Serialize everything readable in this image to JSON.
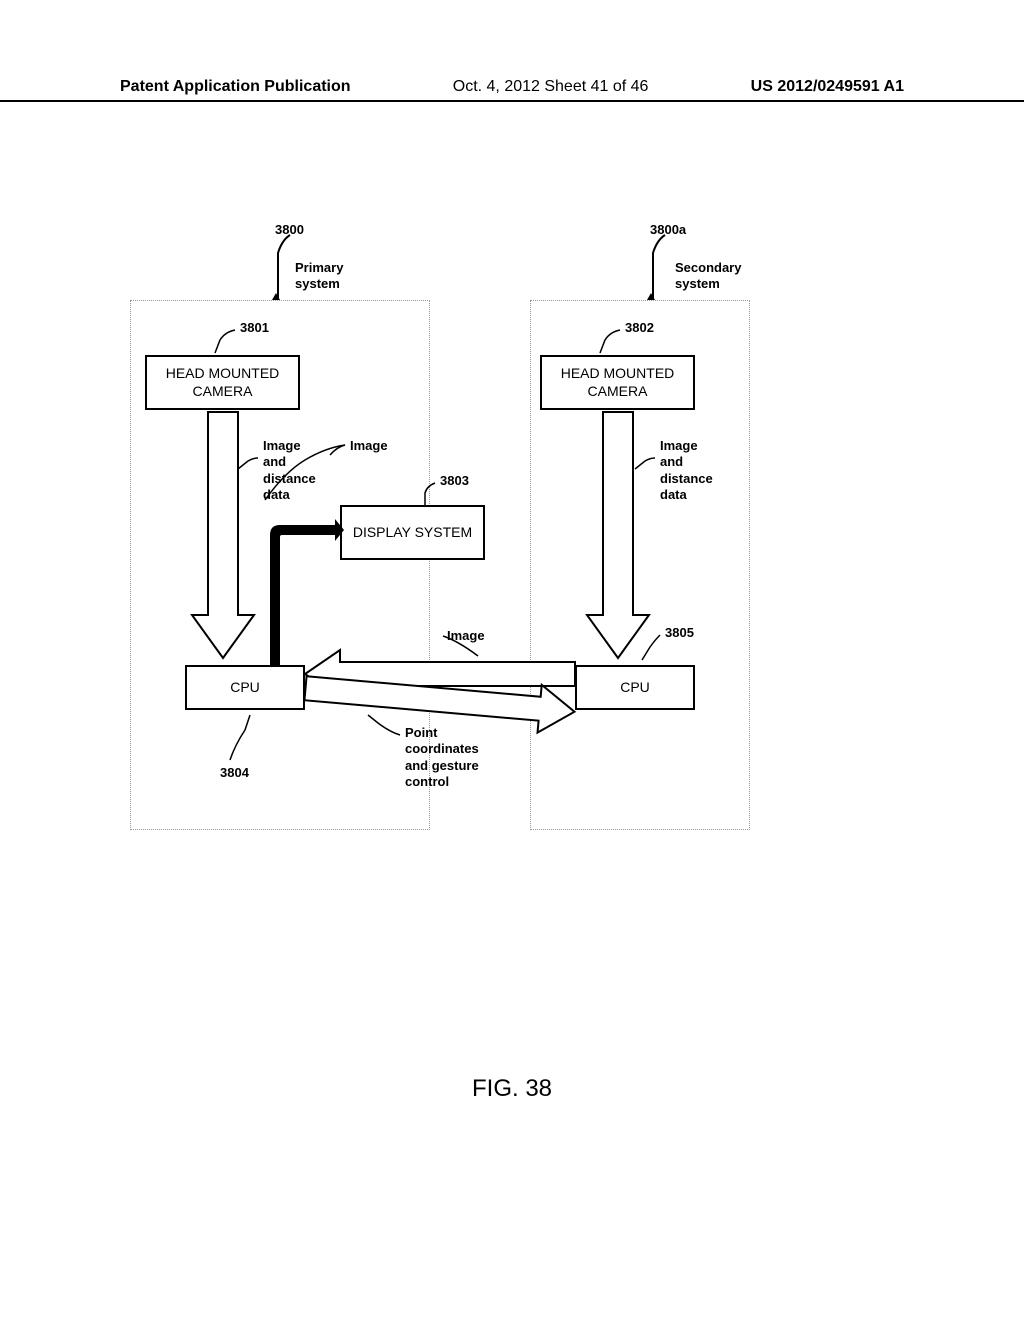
{
  "header": {
    "left": "Patent Application Publication",
    "mid": "Oct. 4, 2012   Sheet 41 of 46",
    "right": "US 2012/0249591 A1"
  },
  "refs": {
    "primary_sys": "3800",
    "secondary_sys": "3800a",
    "cam_left": "3801",
    "cam_right": "3802",
    "display": "3803",
    "cpu_left": "3804",
    "cpu_right": "3805"
  },
  "labels": {
    "primary_sys": "Primary\nsystem",
    "secondary_sys": "Secondary\nsystem",
    "cam_left": "HEAD MOUNTED\nCAMERA",
    "cam_right": "HEAD MOUNTED\nCAMERA",
    "display": "DISPLAY SYSTEM",
    "cpu_left": "CPU",
    "cpu_right": "CPU",
    "image_dist_left": "Image\nand\ndistance\ndata",
    "image_annot": "Image",
    "image_dist_right": "Image\nand\ndistance\ndata",
    "image_arrow": "Image",
    "point_coords": "Point\ncoordinates\nand gesture\ncontrol"
  },
  "figure_caption": "FIG. 38"
}
